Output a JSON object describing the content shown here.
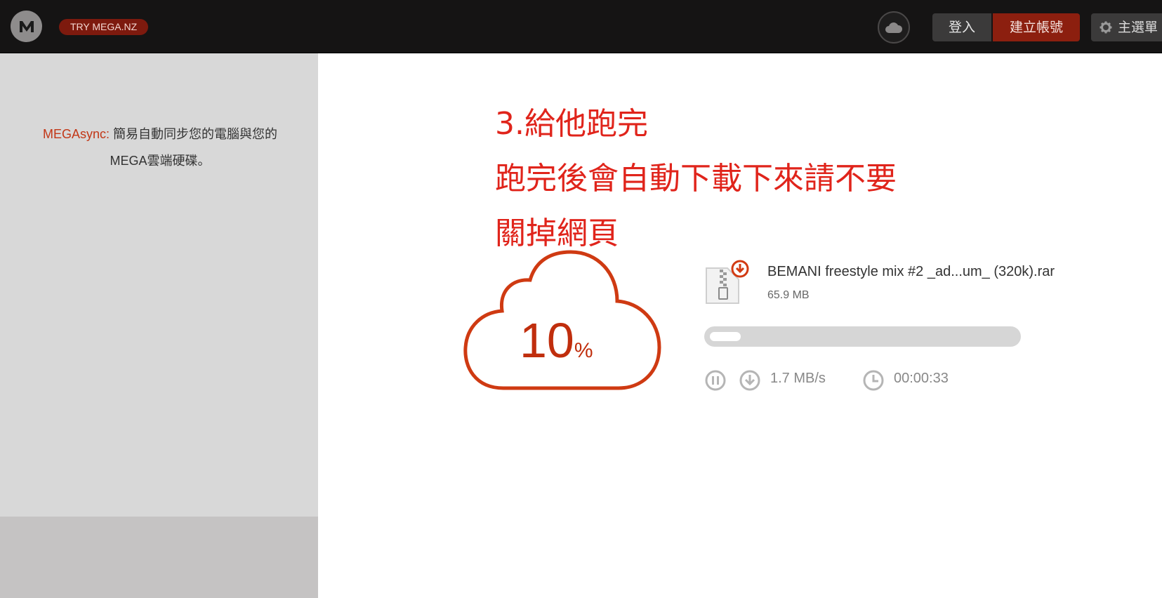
{
  "header": {
    "logo_letter": "M",
    "try_badge": "TRY MEGA.NZ",
    "login_label": "登入",
    "register_label": "建立帳號",
    "menu_label": "主選單",
    "icons": [
      "mega-logo-icon",
      "cloud-icon",
      "gear-icon"
    ]
  },
  "sidebar": {
    "promo_brand": "MEGAsync:",
    "promo_text_line1": "簡易自動同步您的電腦與您的",
    "promo_text_line2": "MEGA雲端硬碟。"
  },
  "annotation": {
    "line1": "3.給他跑完",
    "line2": "跑完後會自動下載下來請不要",
    "line3": "關掉網頁"
  },
  "download": {
    "percent": "10",
    "percent_symbol": "%",
    "progress_fraction": 0.1,
    "file_name": "BEMANI freestyle mix #2 _ad...um_ (320k).rar",
    "file_size": "65.9 MB",
    "speed": "1.7 MB/s",
    "time_remaining": "00:00:33",
    "icons": [
      "zip-file-icon",
      "download-badge-icon",
      "pause-icon",
      "download-icon",
      "clock-icon"
    ]
  },
  "colors": {
    "accent": "#c23616",
    "annotation": "#e0241b",
    "topbar": "#151414"
  }
}
